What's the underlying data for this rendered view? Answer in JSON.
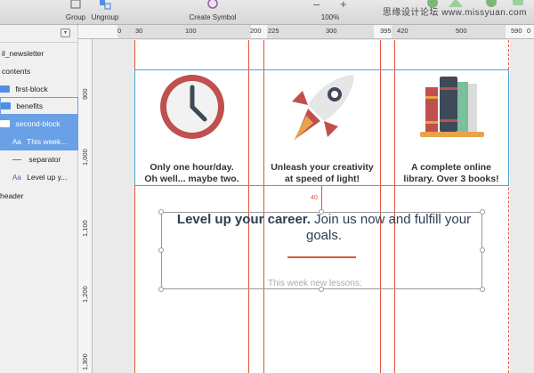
{
  "toolbar": {
    "group_label": "Group",
    "ungroup_label": "Ungroup",
    "create_symbol_label": "Create Symbol",
    "zoom_minus": "–",
    "zoom_plus": "+",
    "zoom_level": "100%",
    "watermark": "思缘设计论坛 www.missyuan.com"
  },
  "sidebar": {
    "items": [
      {
        "label": "il_newsletter",
        "type": "page"
      },
      {
        "label": "contents",
        "type": "group"
      },
      {
        "label": "first-block",
        "type": "folder"
      },
      {
        "label": "benefits",
        "type": "folder"
      },
      {
        "label": "second-block",
        "type": "folder"
      },
      {
        "label": "This week...",
        "type": "text"
      },
      {
        "label": "separator",
        "type": "line"
      },
      {
        "label": "Level up y...",
        "type": "text"
      },
      {
        "label": "header",
        "type": "group"
      }
    ]
  },
  "ruler_h": [
    "0",
    "30",
    "100",
    "200",
    "225",
    "300",
    "395",
    "420",
    "500",
    "590",
    "0"
  ],
  "ruler_v": [
    "900",
    "1,000",
    "1,100",
    "1,200",
    "1,300"
  ],
  "canvas": {
    "columns": [
      {
        "line1": "Only one hour/day.",
        "line2": "Oh well... maybe two.",
        "icon": "clock-icon"
      },
      {
        "line1": "Unleash your creativity",
        "line2": "at speed of light!",
        "icon": "rocket-icon"
      },
      {
        "line1": "A complete online",
        "line2": "library. Over 3 books!",
        "icon": "books-icon"
      }
    ],
    "measure": "40",
    "headline_bold": "Level up your career.",
    "headline_rest": " Join us now and fulfill your goals.",
    "subtext": "This week new lessons:"
  },
  "colors": {
    "guide": "#e2533c",
    "selection": "#6aa0e6",
    "frame": "#49a3d3"
  }
}
